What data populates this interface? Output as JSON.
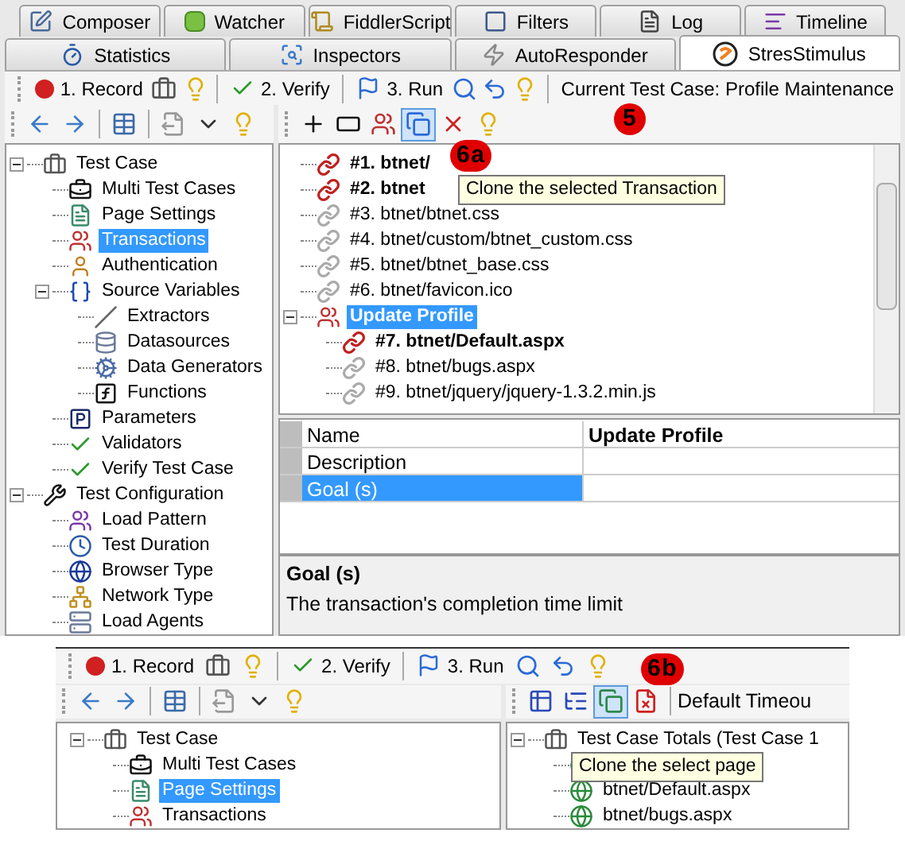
{
  "tabs_row_1": [
    {
      "label": "Composer",
      "kind": "note",
      "selected": false
    },
    {
      "label": "Watcher",
      "kind": "green",
      "selected": false
    },
    {
      "label": "FiddlerScript",
      "kind": "script",
      "selected": false
    },
    {
      "label": "Filters",
      "kind": "checkbox",
      "selected": false
    },
    {
      "label": "Log",
      "kind": "log",
      "selected": false
    },
    {
      "label": "Timeline",
      "kind": "timeline",
      "selected": false
    }
  ],
  "tabs_row_2": [
    {
      "label": "Statistics",
      "kind": "stopwatch",
      "selected": false
    },
    {
      "label": "Inspectors",
      "kind": "inspect",
      "selected": false
    },
    {
      "label": "AutoResponder",
      "kind": "bolt",
      "selected": false
    },
    {
      "label": "StresStimulus",
      "kind": "logo",
      "selected": true
    }
  ],
  "main_toolbar": {
    "buttons": [
      {
        "label": "1. Record",
        "kind": "record"
      },
      {
        "kind": "briefcase"
      },
      {
        "kind": "bulb"
      },
      {
        "kind": "sep"
      },
      {
        "label": "2. Verify",
        "kind": "check"
      },
      {
        "kind": "sep"
      },
      {
        "label": "3. Run",
        "kind": "flag"
      },
      {
        "kind": "search"
      },
      {
        "kind": "undo"
      },
      {
        "kind": "bulb"
      },
      {
        "kind": "sep"
      }
    ],
    "current_test_case": "Current Test Case: Profile Maintenance",
    "callout": "5"
  },
  "nav_toolbar": [
    {
      "kind": "back"
    },
    {
      "kind": "forward"
    },
    {
      "kind": "sep"
    },
    {
      "kind": "table"
    },
    {
      "kind": "sep"
    },
    {
      "kind": "export"
    },
    {
      "kind": "caret"
    },
    {
      "kind": "bulb"
    }
  ],
  "transaction_toolbar": {
    "buttons": [
      {
        "kind": "plus",
        "selected": false
      },
      {
        "kind": "minus",
        "selected": false
      },
      {
        "kind": "people",
        "selected": false
      },
      {
        "kind": "clone",
        "selected": true
      },
      {
        "kind": "delete",
        "selected": false
      },
      {
        "kind": "bulb",
        "selected": false
      }
    ],
    "callout": "6a",
    "tooltip": "Clone the selected Transaction"
  },
  "test_tree": [
    {
      "label": "Test Case",
      "kind": "briefcase",
      "selected": false,
      "expanded": true,
      "children": [
        {
          "label": "Multi Test Cases",
          "kind": "briefcases",
          "selected": false
        },
        {
          "label": "Page Settings",
          "kind": "page",
          "selected": false
        },
        {
          "label": "Transactions",
          "kind": "people",
          "selected": true
        },
        {
          "label": "Authentication",
          "kind": "auth",
          "selected": false
        },
        {
          "label": "Source Variables",
          "kind": "braces",
          "selected": false,
          "expanded": true,
          "children": [
            {
              "label": "Extractors",
              "kind": "line",
              "selected": false
            },
            {
              "label": "Datasources",
              "kind": "database",
              "selected": false
            },
            {
              "label": "Data Generators",
              "kind": "gear",
              "selected": false
            },
            {
              "label": "Functions",
              "kind": "function",
              "selected": false
            }
          ]
        },
        {
          "label": "Parameters",
          "kind": "param",
          "selected": false
        },
        {
          "label": "Validators",
          "kind": "validate",
          "selected": false
        },
        {
          "label": "Verify Test Case",
          "kind": "verify",
          "selected": false
        }
      ]
    },
    {
      "label": "Test Configuration",
      "kind": "wrench",
      "selected": false,
      "expanded": true,
      "children": [
        {
          "label": "Load Pattern",
          "kind": "users",
          "selected": false
        },
        {
          "label": "Test Duration",
          "kind": "clock",
          "selected": false
        },
        {
          "label": "Browser Type",
          "kind": "globe",
          "selected": false
        },
        {
          "label": "Network Type",
          "kind": "network",
          "selected": false
        },
        {
          "label": "Load Agents",
          "kind": "server",
          "selected": false
        }
      ]
    }
  ],
  "transaction_tree": [
    {
      "label": "#1. btnet/",
      "kind": "link",
      "emphasized": true,
      "selected": false
    },
    {
      "label": "#2. btnet",
      "kind": "link",
      "emphasized": true,
      "selected": false
    },
    {
      "label": "#3. btnet/btnet.css",
      "kind": "link",
      "emphasized": false,
      "selected": false
    },
    {
      "label": "#4. btnet/custom/btnet_custom.css",
      "kind": "link",
      "emphasized": false,
      "selected": false
    },
    {
      "label": "#5. btnet/btnet_base.css",
      "kind": "link",
      "emphasized": false,
      "selected": false
    },
    {
      "label": "#6. btnet/favicon.ico",
      "kind": "link",
      "emphasized": false,
      "selected": false
    },
    {
      "label": "Update Profile",
      "kind": "people",
      "emphasized": true,
      "selected": true,
      "expanded": true,
      "children": [
        {
          "label": "#7. btnet/Default.aspx",
          "kind": "link",
          "emphasized": true,
          "selected": false
        },
        {
          "label": "#8. btnet/bugs.aspx",
          "kind": "link",
          "emphasized": false,
          "selected": false
        },
        {
          "label": "#9. btnet/jquery/jquery-1.3.2.min.js",
          "kind": "link",
          "emphasized": false,
          "selected": false
        }
      ]
    }
  ],
  "properties": [
    {
      "name": "Name",
      "value": "Update Profile",
      "selected": false
    },
    {
      "name": "Description",
      "selected": false
    },
    {
      "name": "Goal (s)",
      "selected": true
    }
  ],
  "description": {
    "title": "Goal (s)",
    "text": "The transaction's completion time limit"
  },
  "inset": {
    "main_toolbar": [
      {
        "label": "1. Record",
        "kind": "record"
      },
      {
        "kind": "briefcase"
      },
      {
        "kind": "bulb"
      },
      {
        "kind": "sep"
      },
      {
        "label": "2. Verify",
        "kind": "check"
      },
      {
        "kind": "sep"
      },
      {
        "label": "3. Run",
        "kind": "flag"
      },
      {
        "kind": "search"
      },
      {
        "kind": "undo"
      },
      {
        "kind": "bulb"
      }
    ],
    "callout": "6b",
    "nav_toolbar": [
      {
        "kind": "back"
      },
      {
        "kind": "forward"
      },
      {
        "kind": "sep"
      },
      {
        "kind": "table"
      },
      {
        "kind": "sep"
      },
      {
        "kind": "export"
      },
      {
        "kind": "caret"
      },
      {
        "kind": "bulb"
      }
    ],
    "page_toolbar": {
      "buttons": [
        {
          "kind": "grid",
          "selected": false
        },
        {
          "kind": "treeview",
          "selected": false
        },
        {
          "kind": "clonepage",
          "selected": true
        },
        {
          "kind": "deletepage",
          "selected": false
        }
      ],
      "label": "Default Timeou"
    },
    "test_tree": [
      {
        "label": "Test Case",
        "kind": "briefcase",
        "selected": false,
        "expanded": true,
        "children": [
          {
            "label": "Multi Test Cases",
            "kind": "briefcases",
            "selected": false
          },
          {
            "label": "Page Settings",
            "kind": "page",
            "selected": true
          },
          {
            "label": "Transactions",
            "kind": "people",
            "selected": false
          }
        ]
      }
    ],
    "results_tree": [
      {
        "label": "Test Case Totals (Test Case 1",
        "kind": "briefcase",
        "expanded": true,
        "children": [
          {
            "kind": "globepage"
          },
          {
            "label": "btnet/Default.aspx",
            "kind": "globepage"
          },
          {
            "label": "btnet/bugs.aspx",
            "kind": "globepage"
          }
        ]
      }
    ],
    "tooltip": "Clone the select page"
  }
}
